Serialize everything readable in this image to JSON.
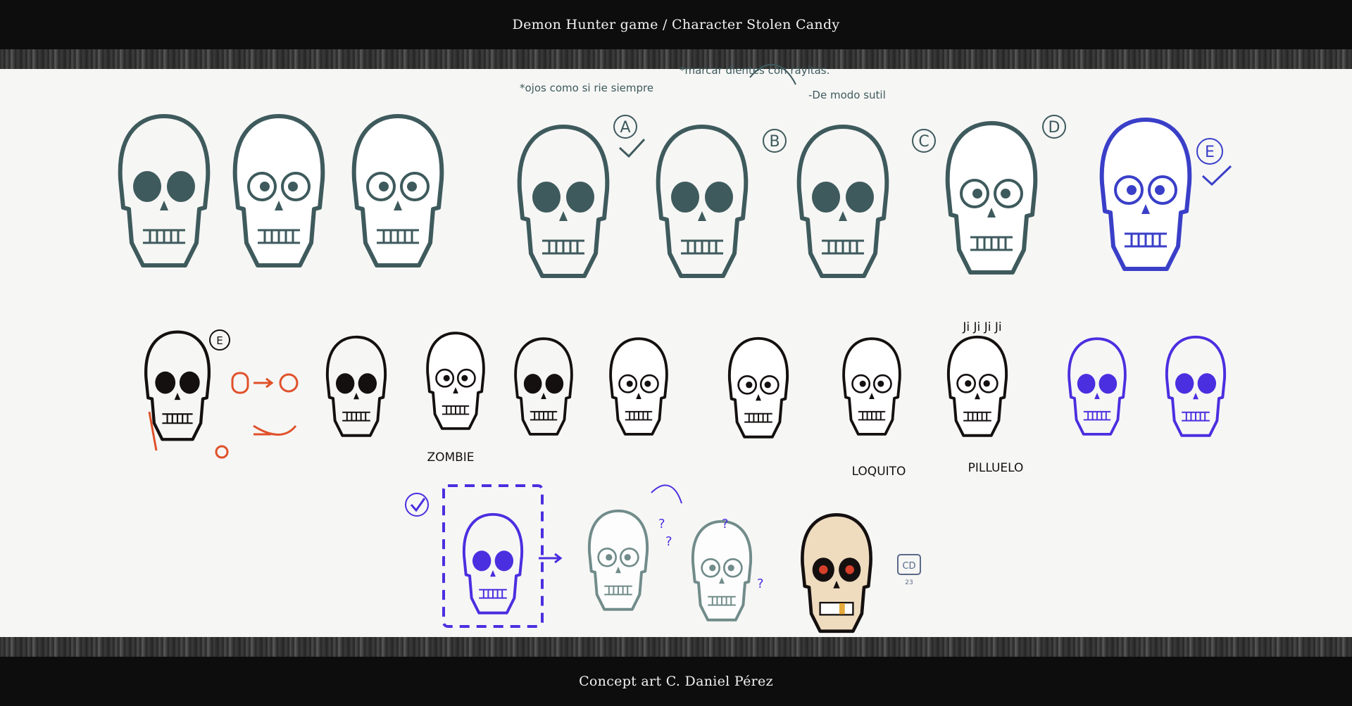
{
  "header": {
    "title": "Demon Hunter game / Character Stolen Candy"
  },
  "footer": {
    "credit": "Concept art C. Daniel Pérez"
  },
  "notes": {
    "note_a": "*ojos como si rie siempre",
    "note_b": "*marcar dientes con rayitas.",
    "note_c": "-De modo sutil"
  },
  "labels": {
    "a": "A",
    "b": "B",
    "c": "C",
    "d": "D",
    "e": "E",
    "e2": "E",
    "zombie": "ZOMBIE",
    "loquito": "LOQUITO",
    "pilluelo": "PILLUELO",
    "jijiji": "Ji Ji Ji Ji",
    "q1": "?",
    "q2": "?",
    "q3": "?",
    "q4": "?",
    "signature": "CD",
    "year": "23"
  },
  "colors": {
    "teal": "#3e5a5c",
    "blue": "#3a3fc8",
    "violet": "#4a2fe0",
    "ink": "#151010",
    "orange": "#e0512a",
    "bone": "#efdcbf"
  }
}
